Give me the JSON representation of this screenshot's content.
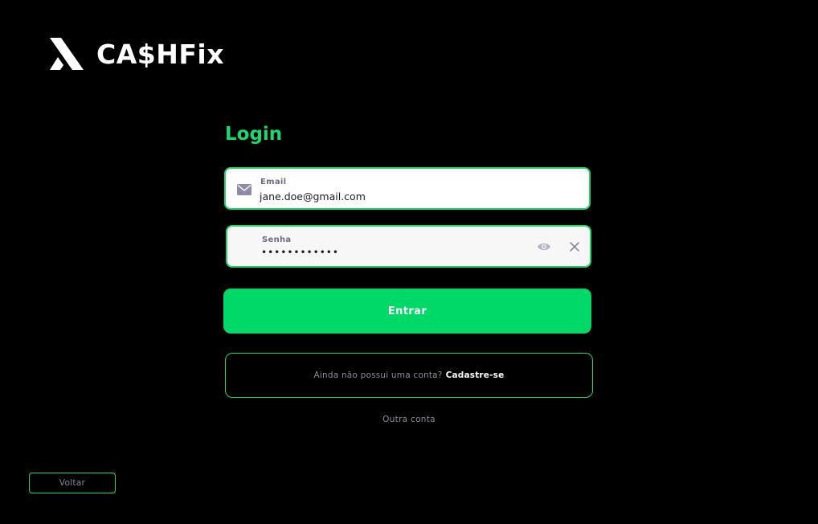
{
  "brand": {
    "name": "CA$HFix",
    "logo_icon": "cashfix-logo-icon"
  },
  "login": {
    "title": "Login"
  },
  "email": {
    "label": "Email",
    "value": "jane.doe@gmail.com",
    "icon": "mail-icon"
  },
  "password": {
    "label": "Senha",
    "value": "••••••••••••",
    "show_icon": "eye-icon",
    "clear_icon": "close-icon"
  },
  "actions": {
    "enter_label": "Entrar",
    "signup_prompt": "Ainda não possui uma conta?",
    "signup_link": "Cadastre-se",
    "other_account": "Outra conta",
    "back_label": "Voltar"
  },
  "colors": {
    "background": "#000000",
    "accent": "#1ed66a",
    "button": "#00d868",
    "muted_text": "#8a8a9a",
    "field_label": "#6b6a86"
  }
}
